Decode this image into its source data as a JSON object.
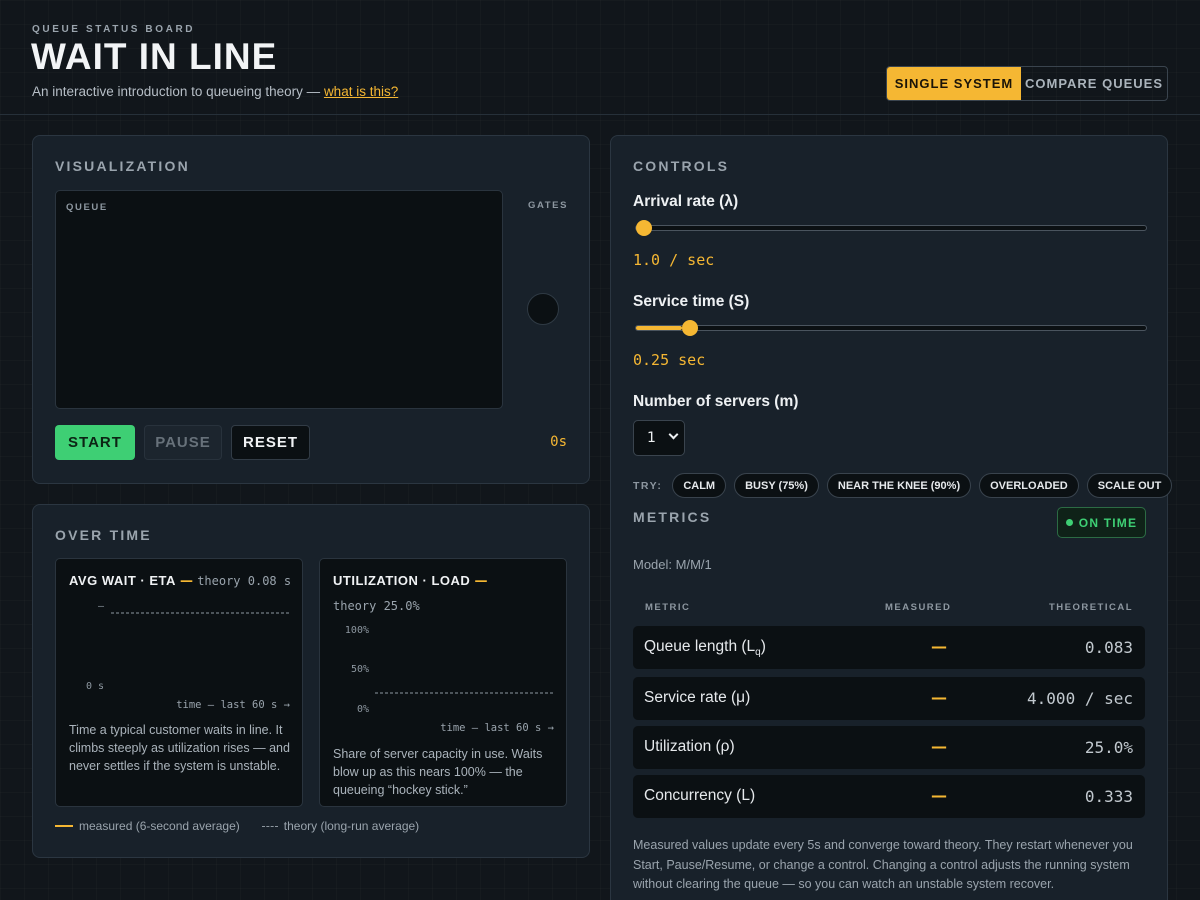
{
  "header": {
    "eyebrow": "QUEUE STATUS BOARD",
    "title": "WAIT IN LINE",
    "subtitle": "An interactive introduction to queueing theory — ",
    "subtitle_link": "what is this?",
    "modes": {
      "single": "SINGLE SYSTEM",
      "compare": "COMPARE QUEUES",
      "active": "single"
    }
  },
  "visualization": {
    "title": "VISUALIZATION",
    "queue_label": "QUEUE",
    "gates_label": "GATES",
    "buttons": {
      "start": "START",
      "pause": "PAUSE",
      "reset": "RESET"
    },
    "clock": "0s"
  },
  "over_time": {
    "title": "OVER TIME",
    "wait_chart": {
      "name": "AVG WAIT · ETA",
      "dash": "—",
      "theory": "theory 0.08 s",
      "y_top_label": "—",
      "y_bottom_label": "0 s",
      "x_label": "time — last 60 s →",
      "description": "Time a typical customer waits in line. It climbs steeply as utilization rises — and never settles if the system is unstable."
    },
    "util_chart": {
      "name": "UTILIZATION · LOAD",
      "dash": "—",
      "theory": "theory 25.0%",
      "y_ticks": [
        "100%",
        "50%",
        "0%"
      ],
      "x_label": "time — last 60 s →",
      "description": "Share of server capacity in use. Waits blow up as this nears 100% — the queueing “hockey stick.”"
    },
    "legend": {
      "measured": "measured (6-second average)",
      "theory": "theory (long-run average)"
    }
  },
  "controls": {
    "title": "CONTROLS",
    "arrival": {
      "label": "Arrival rate (λ)",
      "value": "1.0 / sec",
      "fraction": 0.0
    },
    "service": {
      "label": "Service time (S)",
      "value": "0.25 sec",
      "fraction": 0.09
    },
    "servers": {
      "label": "Number of servers (m)",
      "selected": "1"
    },
    "try_label": "TRY:",
    "presets": [
      "CALM",
      "BUSY (75%)",
      "NEAR THE KNEE (90%)",
      "OVERLOADED",
      "SCALE OUT"
    ]
  },
  "metrics": {
    "title": "METRICS",
    "status": "ON TIME",
    "model": "Model: M/M/1",
    "headers": {
      "metric": "METRIC",
      "measured": "MEASURED",
      "theoretical": "THEORETICAL"
    },
    "rows": [
      {
        "name": "Queue length (L",
        "sub": "q",
        "name_end": ")",
        "measured": "—",
        "theoretical": "0.083"
      },
      {
        "name": "Service rate (μ)",
        "sub": "",
        "name_end": "",
        "measured": "—",
        "theoretical": "4.000 / sec"
      },
      {
        "name": "Utilization (ρ)",
        "sub": "",
        "name_end": "",
        "measured": "—",
        "theoretical": "25.0%"
      },
      {
        "name": "Concurrency (L)",
        "sub": "",
        "name_end": "",
        "measured": "—",
        "theoretical": "0.333"
      }
    ],
    "footnote": "Measured values update every 5s and converge toward theory. They restart whenever you Start, Pause/Resume, or change a control. Changing a control adjusts the running system without clearing the queue — so you can watch an unstable system recover."
  },
  "colors": {
    "accent": "#f5b733",
    "success": "#3ecf74",
    "panel": "#18212a",
    "inset": "#0b1013"
  }
}
